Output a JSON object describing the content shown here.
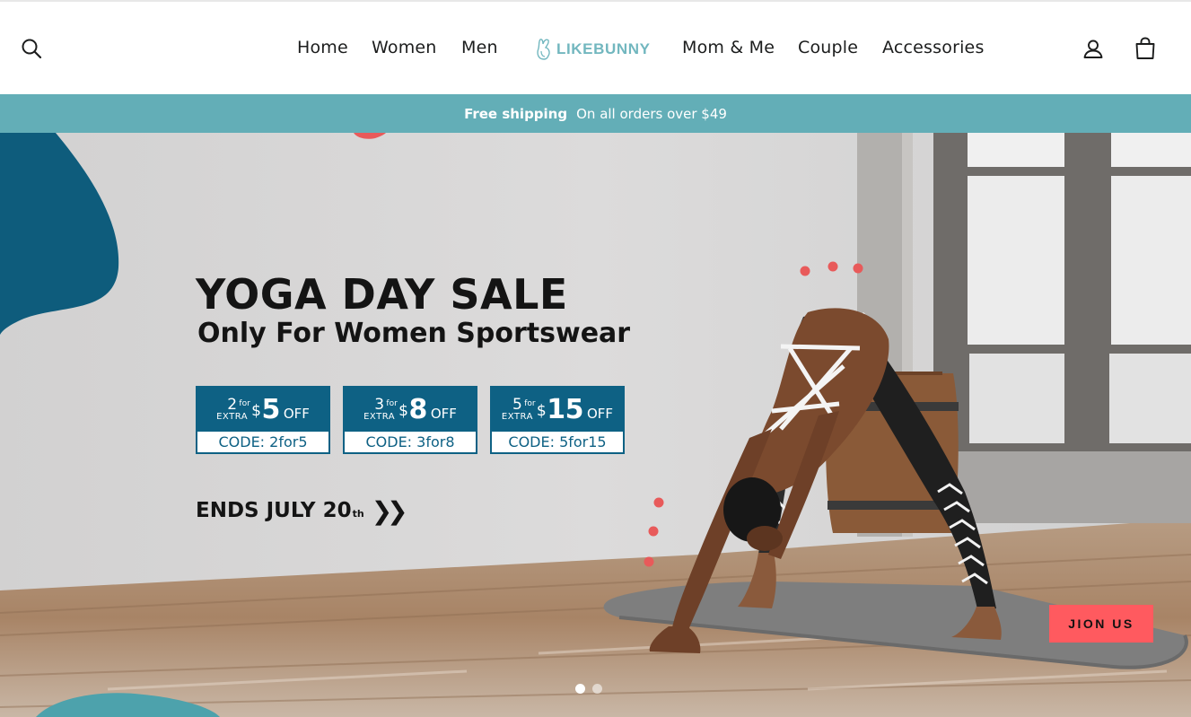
{
  "header": {
    "nav_left": [
      "Home",
      "Women",
      "Men"
    ],
    "logo_text": "LIKEBUNNY",
    "nav_right": [
      "Mom & Me",
      "Couple",
      "Accessories"
    ]
  },
  "announcement": {
    "bold": "Free shipping",
    "text": "On all orders over $49"
  },
  "hero": {
    "headline": "YOGA DAY SALE",
    "subhead": "Only For Women Sportswear",
    "coupons": [
      {
        "qty": "2",
        "for": "for",
        "extra": "EXTRA",
        "currency": "$",
        "amount": "5",
        "off": "OFF",
        "code": "CODE: 2for5"
      },
      {
        "qty": "3",
        "for": "for",
        "extra": "EXTRA",
        "currency": "$",
        "amount": "8",
        "off": "OFF",
        "code": "CODE: 3for8"
      },
      {
        "qty": "5",
        "for": "for",
        "extra": "EXTRA",
        "currency": "$",
        "amount": "15",
        "off": "OFF",
        "code": "CODE: 5for15"
      }
    ],
    "ends_text": "ENDS JULY 20",
    "ends_suffix": "th",
    "ends_arrows": "❯❯",
    "join_label": "JION US",
    "slides_total": 2,
    "slide_active": 1
  },
  "colors": {
    "accent_teal": "#63aeb7",
    "coupon_blue": "#0e6184",
    "join_red": "#ff5a5f",
    "logo_teal": "#72b7bf"
  },
  "icons": {
    "search": "search-icon",
    "account": "account-icon",
    "cart": "cart-bag-icon",
    "logo": "bunny-logo-icon"
  }
}
